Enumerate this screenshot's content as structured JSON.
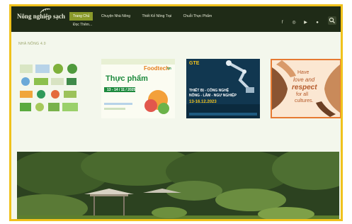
{
  "site": {
    "logo_text": "Nông nghiệp sạch"
  },
  "nav": {
    "items": [
      {
        "label": "Trang Chủ",
        "active": true
      },
      {
        "label": "Chuyện Nhà Nông"
      },
      {
        "label": "Thiết Kế Nông Trại"
      },
      {
        "label": "Chuỗi Thực Phẩm"
      },
      {
        "label": "Đọc Thêm..."
      }
    ],
    "social_icons": [
      "facebook-icon",
      "instagram-icon",
      "youtube-icon",
      "chat-icon",
      "search-icon"
    ]
  },
  "section": {
    "title": "NHÀ NÔNG 4.0"
  },
  "cards": [
    {
      "name": "certification-logos"
    },
    {
      "name": "foodtech-vietnam",
      "brand": "Foodtech",
      "brand_suffix": "vn",
      "headline": "Thực phẩm",
      "dates": "13 - 14 / 11 / 2025"
    },
    {
      "name": "gte-expo",
      "brand": "GTE",
      "line1": "THIẾT BỊ - CÔNG NGHỆ",
      "line2": "NÔNG - LÂM - NGƯ NGHIỆP",
      "dates": "13-16.12.2023"
    },
    {
      "name": "respect-cultures",
      "line1": "Have",
      "line2": "love and",
      "line3": "respect",
      "line4": "for all",
      "line5": "cultures."
    }
  ],
  "colors": {
    "accent": "#f0c21c",
    "nav_bg": "#1f2b17",
    "active": "#8a9a2a"
  }
}
